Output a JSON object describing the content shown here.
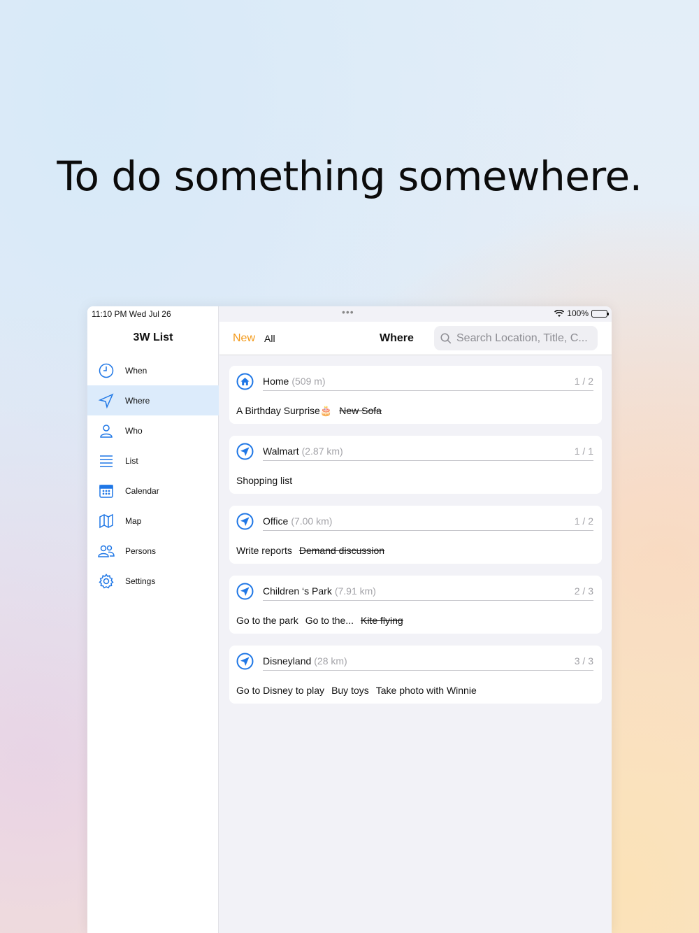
{
  "headline": "To do something somewhere.",
  "status": {
    "time": "11:10 PM  Wed Jul 26",
    "dots": "•••",
    "battery": "100%"
  },
  "sidebar": {
    "title": "3W List",
    "items": [
      {
        "label": "When",
        "icon": "clock-icon",
        "active": false
      },
      {
        "label": "Where",
        "icon": "location-arrow-icon",
        "active": true
      },
      {
        "label": "Who",
        "icon": "person-icon",
        "active": false
      },
      {
        "label": "List",
        "icon": "list-icon",
        "active": false
      },
      {
        "label": "Calendar",
        "icon": "calendar-icon",
        "active": false
      },
      {
        "label": "Map",
        "icon": "map-icon",
        "active": false
      },
      {
        "label": "Persons",
        "icon": "persons-icon",
        "active": false
      },
      {
        "label": "Settings",
        "icon": "gear-icon",
        "active": false
      }
    ]
  },
  "navbar": {
    "new_label": "New",
    "all_label": "All",
    "title": "Where",
    "search_placeholder": "Search Location, Title, C..."
  },
  "locations": [
    {
      "name": "Home",
      "distance": "(509 m)",
      "count": "1 / 2",
      "icon": "home-icon",
      "tasks": [
        {
          "text": "A Birthday Surprise🎂",
          "done": false
        },
        {
          "text": "New Sofa",
          "done": true
        }
      ]
    },
    {
      "name": "Walmart",
      "distance": "(2.87 km)",
      "count": "1 / 1",
      "icon": "location-arrow-icon",
      "tasks": [
        {
          "text": "Shopping list",
          "done": false
        }
      ]
    },
    {
      "name": "Office",
      "distance": "(7.00 km)",
      "count": "1 / 2",
      "icon": "location-arrow-icon",
      "tasks": [
        {
          "text": "Write reports",
          "done": false
        },
        {
          "text": "Demand discussion",
          "done": true
        }
      ]
    },
    {
      "name": "Children ‘s Park",
      "distance": "(7.91 km)",
      "count": "2 / 3",
      "icon": "location-arrow-icon",
      "tasks": [
        {
          "text": "Go to the park",
          "done": false
        },
        {
          "text": "Go to the...",
          "done": false
        },
        {
          "text": "Kite flying",
          "done": true
        }
      ]
    },
    {
      "name": "Disneyland",
      "distance": "(28 km)",
      "count": "3 / 3",
      "icon": "location-arrow-icon",
      "tasks": [
        {
          "text": "Go to Disney to play",
          "done": false
        },
        {
          "text": "Buy toys",
          "done": false
        },
        {
          "text": "Take photo with Winnie",
          "done": false
        }
      ]
    }
  ],
  "colors": {
    "accent": "#1f77e6",
    "new": "#f39a1b",
    "active_bg": "#dcebfb"
  }
}
